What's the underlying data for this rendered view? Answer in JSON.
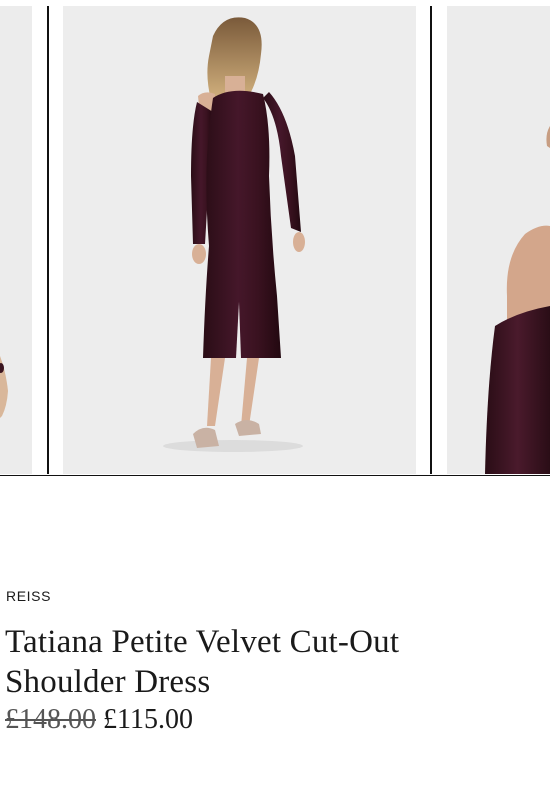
{
  "product": {
    "brand": "REISS",
    "title": "Tatiana Petite Velvet Cut-Out Shoulder Dress",
    "price_original": "£148.00",
    "price_current": "£115.00"
  },
  "gallery": {
    "images": [
      {
        "alt": "Side view crop of model in burgundy velvet dress"
      },
      {
        "alt": "Back view of model in burgundy velvet cut-out shoulder midi dress"
      },
      {
        "alt": "Close-up of cut-out shoulder detail"
      }
    ]
  },
  "colors": {
    "dress": "#3a1420",
    "background": "#ececec",
    "text": "#1a1a1a"
  }
}
